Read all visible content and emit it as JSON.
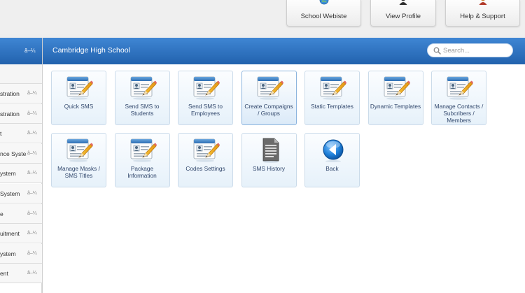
{
  "top_buttons": [
    {
      "label": "School Webiste",
      "icon": "globe-icon"
    },
    {
      "label": "View Profile",
      "icon": "user-profile-icon"
    },
    {
      "label": "Help & Support",
      "icon": "support-agent-icon"
    }
  ],
  "sidebar": {
    "header": "",
    "header_arrow": "â–¼",
    "items": [
      {
        "label": "stration",
        "arrow": "â–¼"
      },
      {
        "label": "stration",
        "arrow": "â–¼"
      },
      {
        "label": "t",
        "arrow": "â–¼"
      },
      {
        "label": "nce System",
        "arrow": "â–¼"
      },
      {
        "label": "ystem",
        "arrow": "â–¼"
      },
      {
        "label": " System",
        "arrow": "â–¼"
      },
      {
        "label": "e",
        "arrow": "â–¼"
      },
      {
        "label": "uitment",
        "arrow": "â–¼"
      },
      {
        "label": "ystem",
        "arrow": "â–¼"
      },
      {
        "label": "ent",
        "arrow": "â–¼"
      }
    ]
  },
  "panel": {
    "title": "Cambridge High School",
    "search_placeholder": "Search..."
  },
  "tiles": [
    {
      "label": "Quick SMS",
      "icon": "form-edit-icon"
    },
    {
      "label": "Send SMS to Students",
      "icon": "form-edit-icon"
    },
    {
      "label": "Send SMS to Employees",
      "icon": "form-edit-icon"
    },
    {
      "label": "Create Compaigns / Groups",
      "icon": "form-edit-icon",
      "active": true
    },
    {
      "label": "Static Templates",
      "icon": "form-edit-icon"
    },
    {
      "label": "Dynamic Templates",
      "icon": "form-edit-icon"
    },
    {
      "label": "Manage Contacts / Subcribers / Members",
      "icon": "form-edit-icon"
    },
    {
      "label": "Manage Masks / SMS Titles",
      "icon": "form-edit-icon"
    },
    {
      "label": "Package Information",
      "icon": "form-edit-icon"
    },
    {
      "label": "Codes Settings",
      "icon": "form-edit-icon"
    },
    {
      "label": "SMS History",
      "icon": "document-icon"
    },
    {
      "label": "Back",
      "icon": "back-arrow-icon"
    }
  ],
  "colors": {
    "header_blue": "#2a6fbf",
    "tile_border": "#cbdbea",
    "tile_text": "#30466b"
  }
}
